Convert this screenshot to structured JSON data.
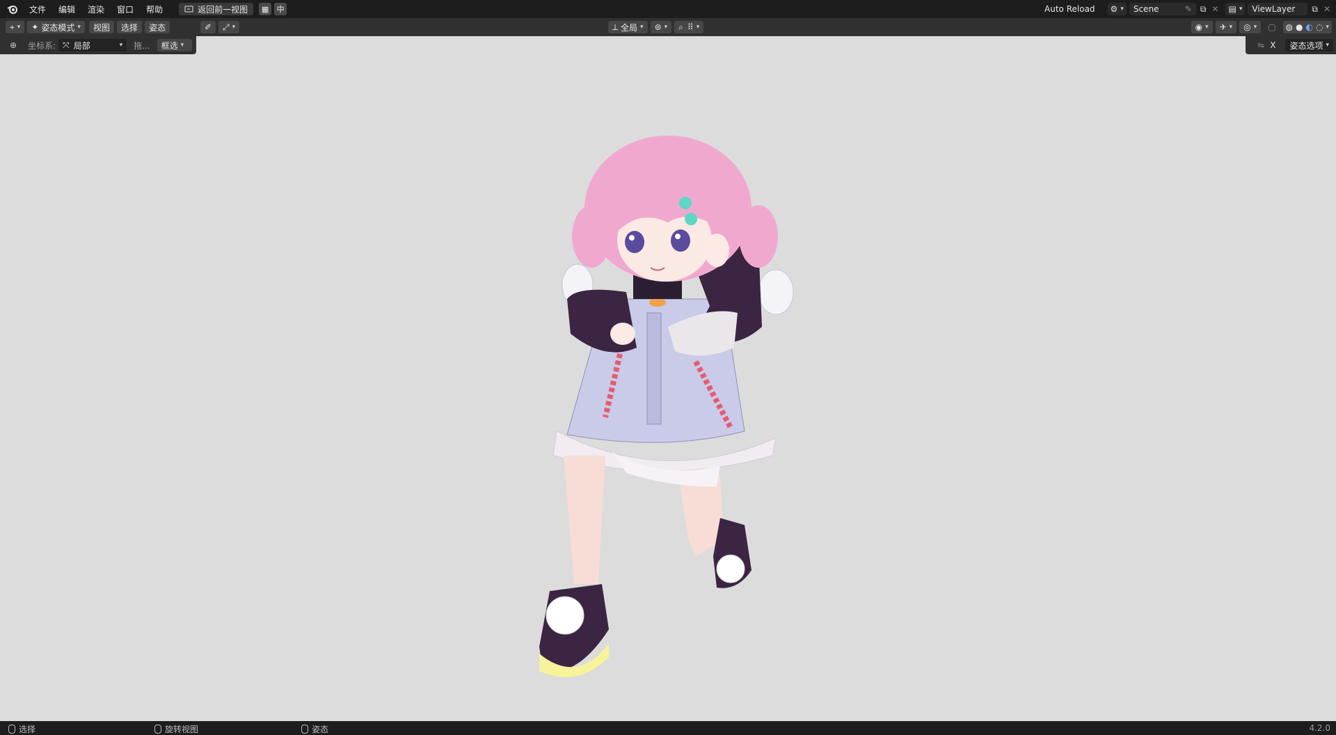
{
  "topbar": {
    "menus": [
      "文件",
      "编辑",
      "渲染",
      "窗口",
      "帮助"
    ],
    "back_button": "返回前一视图",
    "ime_label": "中",
    "auto_reload": "Auto Reload",
    "scene": "Scene",
    "view_layer": "ViewLayer"
  },
  "header": {
    "mode": "姿态模式",
    "menus": [
      "视图",
      "选择",
      "姿态"
    ],
    "orientation": "全局",
    "pose_options": "姿态选项",
    "x_label": "X"
  },
  "toolbar": {
    "coord_label": "坐标系:",
    "coord_value": "局部",
    "drag_label": "拖...",
    "select_mode": "框选"
  },
  "statusbar": {
    "select": "选择",
    "rotate_view": "旋转视图",
    "pose": "姿态",
    "version": "4.2.0"
  },
  "colors": {
    "viewport_bg": "#dcdcdc",
    "hair": "#f1a8cf",
    "sleeve": "#3b2542",
    "jacket": "#c9cbe9",
    "stripe": "#e85a6e",
    "shoe_sole": "#f6f39a"
  },
  "icons": [
    "blender-logo",
    "back-view-icon",
    "grid-icon",
    "mode-icon",
    "eyedropper-icon",
    "transform-icon",
    "pivot-icon",
    "snap-icon",
    "proportional-icon",
    "visibility-icon",
    "gizmo-icon",
    "overlay-icon",
    "xray-icon",
    "wireframe-shading-icon",
    "solid-shading-icon",
    "material-shading-icon",
    "rendered-shading-icon",
    "pin-icon",
    "copy-icon",
    "close-icon",
    "coordinate-icon",
    "mouse-icon",
    "mirror-icon"
  ]
}
